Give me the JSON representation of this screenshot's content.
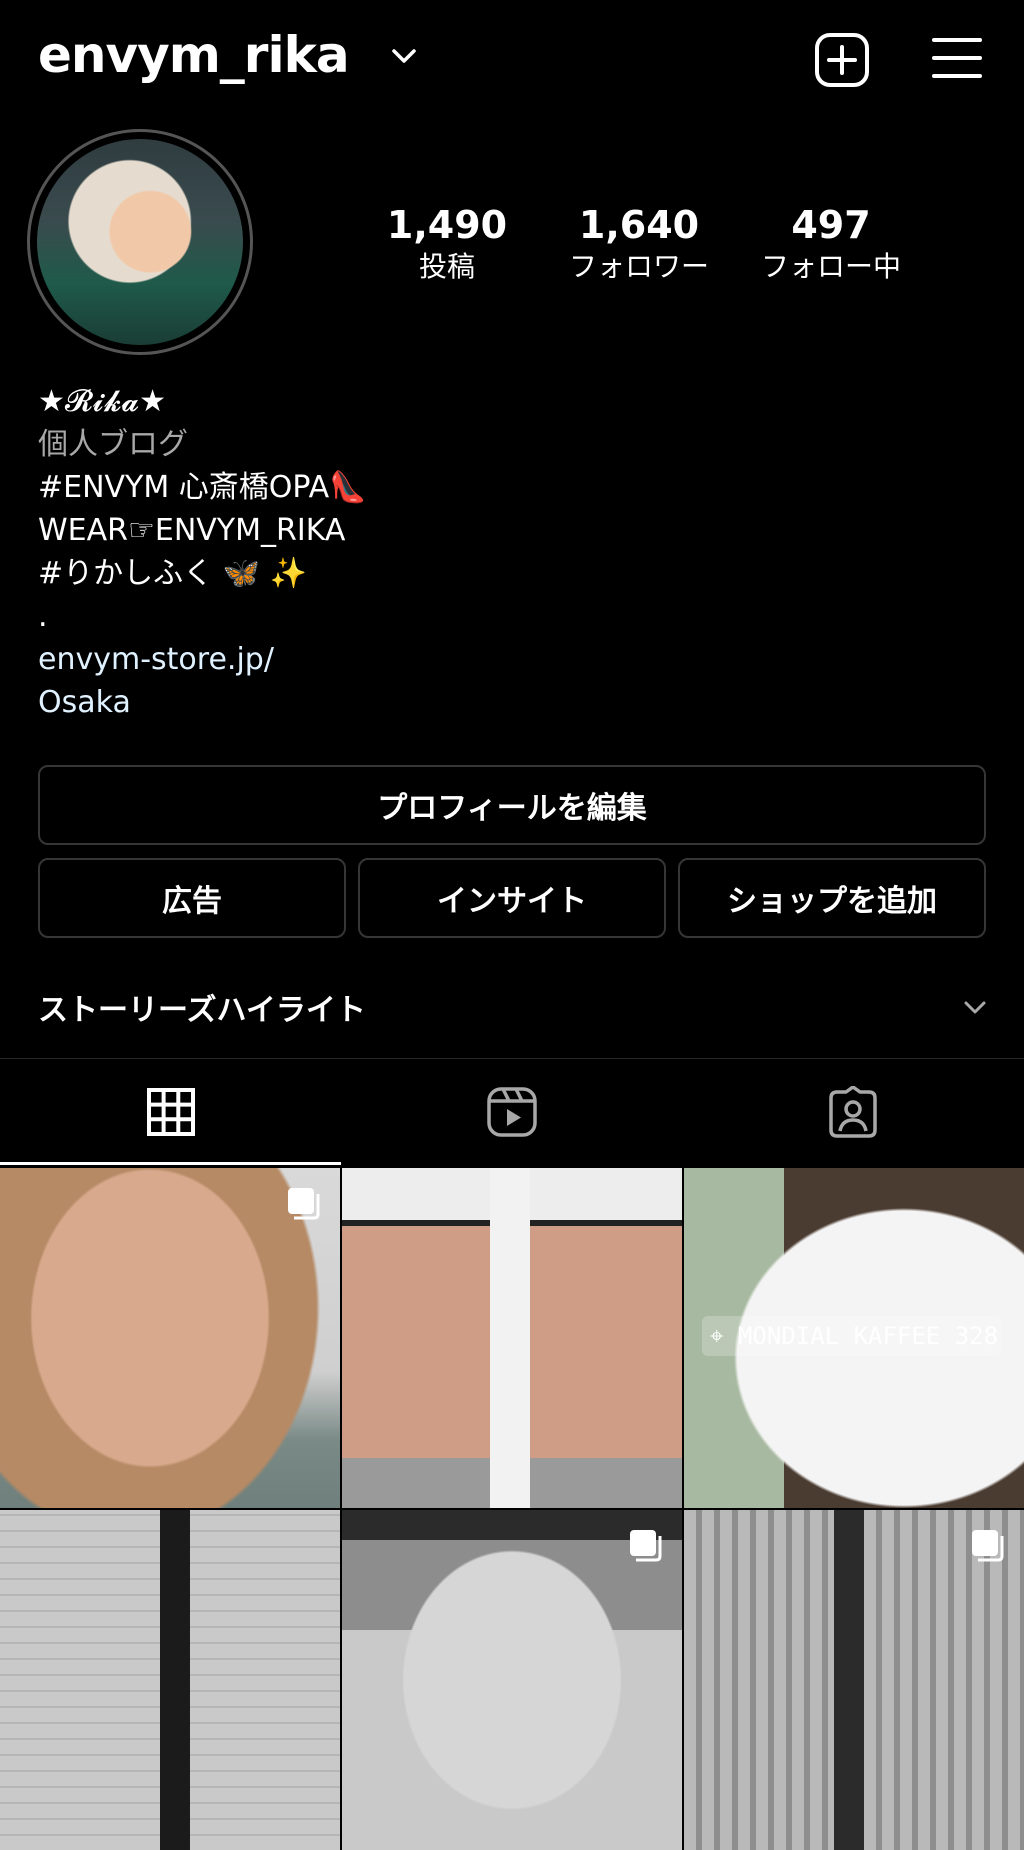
{
  "header": {
    "username": "envym_rika"
  },
  "stats": [
    {
      "count": "1,490",
      "label": "投稿"
    },
    {
      "count": "1,640",
      "label": "フォロワー"
    },
    {
      "count": "497",
      "label": "フォロー中"
    }
  ],
  "bio": {
    "name": "★𝓡𝓲𝓴𝓪★",
    "category": "個人ブログ",
    "lines": [
      "#ENVYM 心斎橋OPA👠",
      "WEAR☞ENVYM_RIKA",
      "#りかしふく 🦋 ✨",
      "."
    ],
    "website": "envym-store.jp/",
    "location": "Osaka"
  },
  "buttons": {
    "edit_profile": "プロフィールを編集",
    "ads": "広告",
    "insights": "インサイト",
    "add_shop": "ショップを追加"
  },
  "highlights": {
    "label": "ストーリーズハイライト"
  },
  "posts": {
    "location_tag": "MONDIAL KAFFEE 328"
  }
}
